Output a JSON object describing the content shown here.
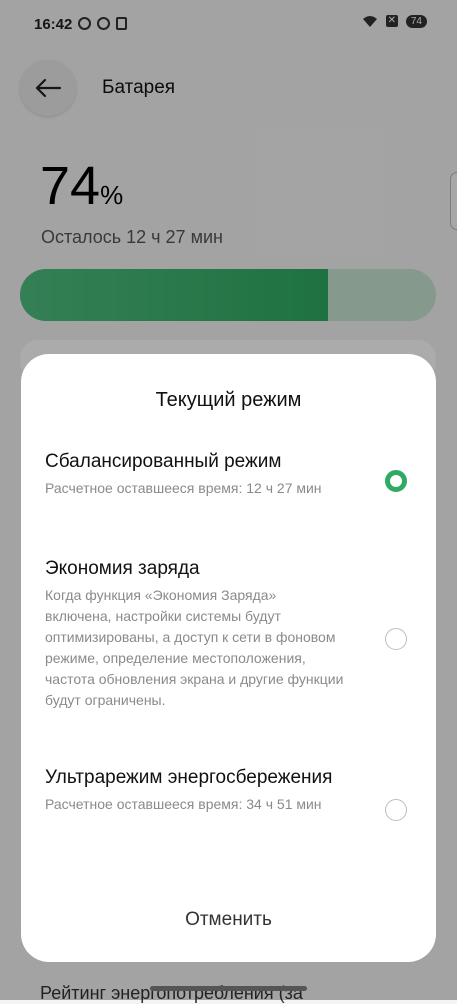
{
  "status_bar": {
    "time": "16:42",
    "battery": "74"
  },
  "header": {
    "title": "Батарея"
  },
  "battery": {
    "percent": "74",
    "percent_sign": "%",
    "level_fraction": 0.74,
    "remaining": "Осталось 12 ч 27 мин"
  },
  "background": {
    "bottom_text": "Рейтинг энергопотребления (за"
  },
  "dialog": {
    "title": "Текущий режим",
    "options": [
      {
        "title": "Сбалансированный режим",
        "desc": "Расчетное оставшееся время: 12 ч 27 мин",
        "selected": true
      },
      {
        "title": "Экономия заряда",
        "desc": "Когда функция «Экономия Заряда» включена, настройки системы будут оптимизированы, а доступ к сети в фоновом режиме, определение местоположения, частота обновления экрана и другие функции будут ограничены.",
        "selected": false
      },
      {
        "title": "Ультрарежим энергосбережения",
        "desc": "Расчетное оставшееся время: 34 ч 51 мин",
        "selected": false
      }
    ],
    "cancel_label": "Отменить"
  },
  "colors": {
    "accent": "#2eaa62"
  }
}
